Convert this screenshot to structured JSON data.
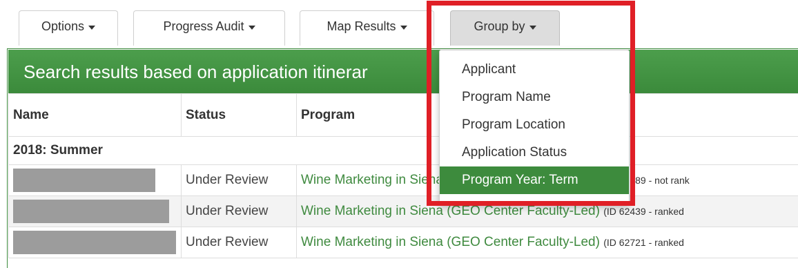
{
  "tabs": [
    {
      "label": "Options"
    },
    {
      "label": "Progress Audit"
    },
    {
      "label": "Map Results"
    },
    {
      "label": "Group by"
    }
  ],
  "banner": {
    "title": "Search results based on application itinerar"
  },
  "table": {
    "headers": [
      "Name",
      "Status",
      "Program"
    ],
    "group_label": "2018: Summer",
    "rows": [
      {
        "status": "Under Review",
        "program": "Wine Marketing in Siena (GEO Center Faculty-Led)",
        "id_text": "(ID 62389 - not rank"
      },
      {
        "status": "Under Review",
        "program": "Wine Marketing in Siena (GEO Center Faculty-Led)",
        "id_text": "(ID 62439 - ranked"
      },
      {
        "status": "Under Review",
        "program": "Wine Marketing in Siena (GEO Center Faculty-Led)",
        "id_text": "(ID 62721 - ranked"
      }
    ]
  },
  "dropdown": {
    "items": [
      {
        "label": "Applicant"
      },
      {
        "label": "Program Name"
      },
      {
        "label": "Program Location"
      },
      {
        "label": "Application Status"
      },
      {
        "label": "Program Year: Term"
      }
    ],
    "selected_index": 4
  },
  "colors": {
    "banner_green": "#3b8a3b",
    "link_green": "#3f8a3f",
    "highlight_red": "#e01f26",
    "selected_bg": "#3d8b3d"
  }
}
